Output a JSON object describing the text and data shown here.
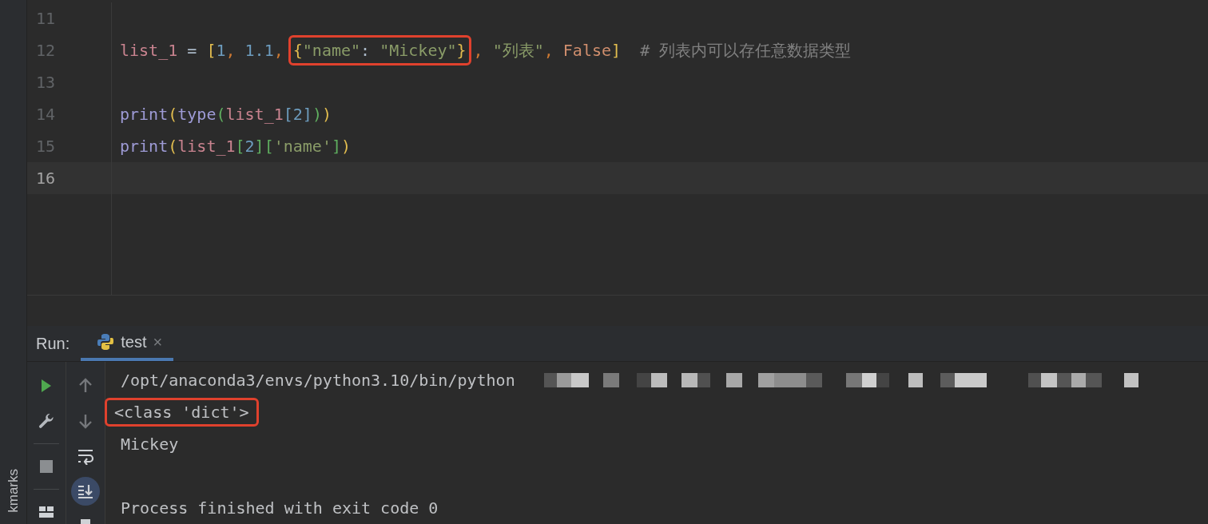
{
  "editor": {
    "lines": [
      {
        "number": "11",
        "current": false
      },
      {
        "number": "12",
        "current": false,
        "segments": [
          {
            "kind": "code",
            "tokens": [
              {
                "text": "list_1",
                "kind": "var"
              },
              {
                "text": " = ",
                "kind": "op"
              },
              {
                "text": "[",
                "kind": "bracket1"
              },
              {
                "text": "1",
                "kind": "number"
              },
              {
                "text": ", ",
                "kind": "comma"
              },
              {
                "text": "1.1",
                "kind": "number"
              },
              {
                "text": ", ",
                "kind": "comma"
              }
            ]
          },
          {
            "kind": "callout",
            "tokens": [
              {
                "text": "{",
                "kind": "bracket1"
              },
              {
                "text": "\"name\"",
                "kind": "string"
              },
              {
                "text": ": ",
                "kind": "op"
              },
              {
                "text": "\"Mickey\"",
                "kind": "string"
              },
              {
                "text": "}",
                "kind": "bracket1"
              }
            ]
          },
          {
            "kind": "code",
            "tokens": [
              {
                "text": ", ",
                "kind": "comma"
              },
              {
                "text": "\"列表\"",
                "kind": "string"
              },
              {
                "text": ", ",
                "kind": "comma"
              },
              {
                "text": "False",
                "kind": "keyword"
              },
              {
                "text": "]",
                "kind": "bracket1"
              },
              {
                "text": "  # 列表内可以存任意数据类型",
                "kind": "comment"
              }
            ]
          }
        ]
      },
      {
        "number": "13",
        "current": false
      },
      {
        "number": "14",
        "current": false,
        "segments": [
          {
            "kind": "code",
            "tokens": [
              {
                "text": "print",
                "kind": "builtin"
              },
              {
                "text": "(",
                "kind": "bracket1"
              },
              {
                "text": "type",
                "kind": "builtin"
              },
              {
                "text": "(",
                "kind": "bracket2"
              },
              {
                "text": "list_1",
                "kind": "var"
              },
              {
                "text": "[",
                "kind": "bracket3"
              },
              {
                "text": "2",
                "kind": "number"
              },
              {
                "text": "]",
                "kind": "bracket3"
              },
              {
                "text": ")",
                "kind": "bracket2"
              },
              {
                "text": ")",
                "kind": "bracket1"
              }
            ]
          }
        ]
      },
      {
        "number": "15",
        "current": false,
        "segments": [
          {
            "kind": "code",
            "tokens": [
              {
                "text": "print",
                "kind": "builtin"
              },
              {
                "text": "(",
                "kind": "bracket1"
              },
              {
                "text": "list_1",
                "kind": "var"
              },
              {
                "text": "[",
                "kind": "bracket2"
              },
              {
                "text": "2",
                "kind": "number"
              },
              {
                "text": "]",
                "kind": "bracket2"
              },
              {
                "text": "[",
                "kind": "bracket2"
              },
              {
                "text": "'name'",
                "kind": "string"
              },
              {
                "text": "]",
                "kind": "bracket2"
              },
              {
                "text": ")",
                "kind": "bracket1"
              }
            ]
          }
        ]
      },
      {
        "number": "16",
        "current": true
      }
    ]
  },
  "run_panel": {
    "label": "Run:",
    "tabs": [
      {
        "label": "test",
        "close": "×",
        "selected": true
      }
    ],
    "toolbar_groups": [
      {
        "buttons": [
          {
            "kind": "run",
            "disabled": false,
            "selected": false
          },
          {
            "kind": "wrench",
            "disabled": false,
            "selected": false
          }
        ]
      },
      {
        "buttons": [
          {
            "kind": "stop",
            "disabled": false,
            "selected": false
          }
        ]
      },
      {
        "buttons": [
          {
            "kind": "layout",
            "disabled": false,
            "selected": false
          }
        ]
      }
    ],
    "toolbar_2": [
      {
        "kind": "up",
        "disabled": true,
        "selected": false
      },
      {
        "kind": "down",
        "disabled": true,
        "selected": false
      },
      {
        "kind": "wrap",
        "disabled": false,
        "selected": false
      },
      {
        "kind": "scroll-end",
        "disabled": false,
        "selected": true
      },
      {
        "kind": "print",
        "disabled": false,
        "selected": false
      }
    ],
    "console": [
      {
        "text": "/opt/anaconda3/envs/python3.10/bin/python",
        "redacted": true,
        "outlined": false
      },
      {
        "text": "<class 'dict'>",
        "redacted": false,
        "outlined": true
      },
      {
        "text": "Mickey",
        "redacted": false,
        "outlined": false
      },
      {
        "text": "Process finished with exit code 0",
        "redacted": false,
        "outlined": false,
        "gap_before": true
      }
    ]
  },
  "side_strip": {
    "label": "kmarks"
  }
}
